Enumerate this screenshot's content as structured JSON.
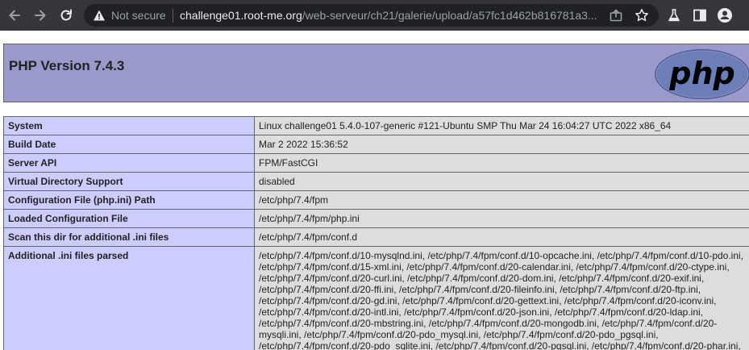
{
  "browser": {
    "security_label": "Not secure",
    "url_host": "challenge01.root-me.org",
    "url_path": "/web-serveur/ch21/galerie/upload/a57fc1d462b816781a3...",
    "icons": [
      "back-arrow-icon",
      "forward-arrow-icon",
      "reload-icon",
      "warning-icon",
      "share-icon",
      "star-icon",
      "lab-flask-icon",
      "side-panel-icon",
      "profile-icon"
    ]
  },
  "header": {
    "title": "PHP Version 7.4.3",
    "logo_text": "php"
  },
  "rows": [
    {
      "key": "System",
      "value": "Linux challenge01 5.4.0-107-generic #121-Ubuntu SMP Thu Mar 24 16:04:27 UTC 2022 x86_64"
    },
    {
      "key": "Build Date",
      "value": "Mar 2 2022 15:36:52"
    },
    {
      "key": "Server API",
      "value": "FPM/FastCGI"
    },
    {
      "key": "Virtual Directory Support",
      "value": "disabled"
    },
    {
      "key": "Configuration File (php.ini) Path",
      "value": "/etc/php/7.4/fpm"
    },
    {
      "key": "Loaded Configuration File",
      "value": "/etc/php/7.4/fpm/php.ini"
    },
    {
      "key": "Scan this dir for additional .ini files",
      "value": "/etc/php/7.4/fpm/conf.d"
    },
    {
      "key": "Additional .ini files parsed",
      "lines": [
        "/etc/php/7.4/fpm/conf.d/10-mysqlnd.ini, /etc/php/7.4/fpm/conf.d/10-opcache.ini, /etc/php/7.4/fpm/conf.d/10-pdo.ini,",
        "/etc/php/7.4/fpm/conf.d/15-xml.ini, /etc/php/7.4/fpm/conf.d/20-calendar.ini, /etc/php/7.4/fpm/conf.d/20-ctype.ini,",
        "/etc/php/7.4/fpm/conf.d/20-curl.ini, /etc/php/7.4/fpm/conf.d/20-dom.ini, /etc/php/7.4/fpm/conf.d/20-exif.ini,",
        "/etc/php/7.4/fpm/conf.d/20-ffi.ini, /etc/php/7.4/fpm/conf.d/20-fileinfo.ini, /etc/php/7.4/fpm/conf.d/20-ftp.ini,",
        "/etc/php/7.4/fpm/conf.d/20-gd.ini, /etc/php/7.4/fpm/conf.d/20-gettext.ini, /etc/php/7.4/fpm/conf.d/20-iconv.ini,",
        "/etc/php/7.4/fpm/conf.d/20-intl.ini, /etc/php/7.4/fpm/conf.d/20-json.ini, /etc/php/7.4/fpm/conf.d/20-ldap.ini,",
        "/etc/php/7.4/fpm/conf.d/20-mbstring.ini, /etc/php/7.4/fpm/conf.d/20-mongodb.ini, /etc/php/7.4/fpm/conf.d/20-",
        "mysqli.ini, /etc/php/7.4/fpm/conf.d/20-pdo_mysql.ini, /etc/php/7.4/fpm/conf.d/20-pdo_pgsql.ini,",
        "/etc/php/7.4/fpm/conf.d/20-pdo_sqlite.ini, /etc/php/7.4/fpm/conf.d/20-pgsql.ini, /etc/php/7.4/fpm/conf.d/20-phar.ini,"
      ]
    }
  ],
  "colors": {
    "toolbar_bg": "#35363a",
    "omnibox_bg": "#202124",
    "header_bg": "#9999cc",
    "key_bg": "#ccccff",
    "value_bg": "#dddddd",
    "logo_bg": "#6c7eb7"
  }
}
